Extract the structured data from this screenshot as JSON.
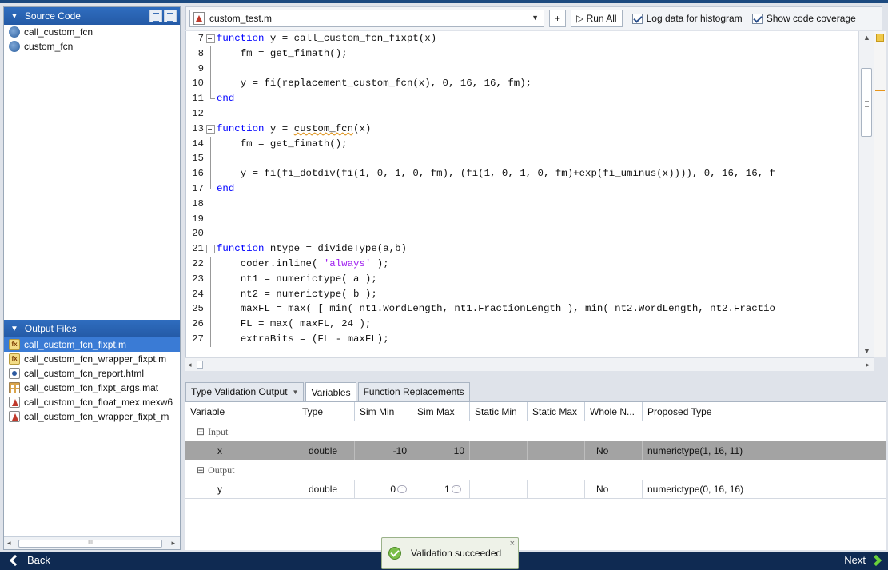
{
  "left": {
    "source_header": "Source Code",
    "source_files": [
      "call_custom_fcn",
      "custom_fcn"
    ],
    "output_header": "Output Files",
    "output_files": [
      {
        "name": "call_custom_fcn_fixpt.m",
        "icon": "fx-m-file-icon",
        "selected": true
      },
      {
        "name": "call_custom_fcn_wrapper_fixpt.m",
        "icon": "fx-m-file-icon",
        "selected": false
      },
      {
        "name": "call_custom_fcn_report.html",
        "icon": "html-file-icon",
        "selected": false
      },
      {
        "name": "call_custom_fcn_fixpt_args.mat",
        "icon": "mat-file-icon",
        "selected": false
      },
      {
        "name": "call_custom_fcn_float_mex.mexw6",
        "icon": "mex-file-icon",
        "selected": false
      },
      {
        "name": "call_custom_fcn_wrapper_fixpt_m",
        "icon": "mex-file-icon",
        "selected": false
      }
    ]
  },
  "toolbar": {
    "file": "custom_test.m",
    "add_label": "+",
    "run_all": "▷ Run All",
    "log_histogram": "Log data for histogram",
    "show_coverage": "Show code coverage"
  },
  "code": {
    "lines": [
      {
        "n": "7",
        "fold": "box",
        "html": "<span class='kw'>function</span> y = call_custom_fcn_fixpt(x)"
      },
      {
        "n": "8",
        "fold": "line",
        "html": "    fm = get_fimath();"
      },
      {
        "n": "9",
        "fold": "line",
        "html": ""
      },
      {
        "n": "10",
        "fold": "line",
        "html": "    y = fi(replacement_custom_fcn(x), 0, 16, 16, fm);"
      },
      {
        "n": "11",
        "fold": "end",
        "html": "<span class='kw'>end</span>"
      },
      {
        "n": "12",
        "fold": "",
        "html": ""
      },
      {
        "n": "13",
        "fold": "box",
        "html": "<span class='kw'>function</span> y = <span class='squig'>custom_fcn</span>(x)"
      },
      {
        "n": "14",
        "fold": "line",
        "html": "    fm = get_fimath();"
      },
      {
        "n": "15",
        "fold": "line",
        "html": ""
      },
      {
        "n": "16",
        "fold": "line",
        "html": "    y = fi(fi_dotdiv(fi(1, 0, 1, 0, fm), (fi(1, 0, 1, 0, fm)+exp(fi_uminus(x)))), 0, 16, 16, f"
      },
      {
        "n": "17",
        "fold": "end",
        "html": "<span class='kw'>end</span>"
      },
      {
        "n": "18",
        "fold": "",
        "html": ""
      },
      {
        "n": "19",
        "fold": "",
        "html": ""
      },
      {
        "n": "20",
        "fold": "",
        "html": ""
      },
      {
        "n": "21",
        "fold": "box",
        "html": "<span class='kw'>function</span> ntype = divideType(a,b)"
      },
      {
        "n": "22",
        "fold": "line",
        "html": "    coder.inline( <span class='str'>'always'</span> );"
      },
      {
        "n": "23",
        "fold": "line",
        "html": "    nt1 = numerictype( a );"
      },
      {
        "n": "24",
        "fold": "line",
        "html": "    nt2 = numerictype( b );"
      },
      {
        "n": "25",
        "fold": "line",
        "html": "    maxFL = max( [ min( nt1.WordLength, nt1.FractionLength ), min( nt2.WordLength, nt2.Fractio"
      },
      {
        "n": "26",
        "fold": "line",
        "html": "    FL = max( maxFL, 24 );"
      },
      {
        "n": "27",
        "fold": "line",
        "html": "    extraBits = (FL - maxFL);"
      }
    ]
  },
  "tabs": [
    "Type Validation Output",
    "Variables",
    "Function Replacements"
  ],
  "table": {
    "headers": [
      "Variable",
      "Type",
      "Sim Min",
      "Sim Max",
      "Static Min",
      "Static Max",
      "Whole N...",
      "Proposed Type"
    ],
    "groups": {
      "input": "Input",
      "output": "Output"
    },
    "rows": [
      {
        "var": "x",
        "type": "double",
        "sim_min": "-10",
        "sim_max": "10",
        "static_min": "",
        "static_max": "",
        "whole": "No",
        "proposed": "numerictype(1, 16, 11)"
      },
      {
        "var": "y",
        "type": "double",
        "sim_min": "0",
        "sim_max": "1",
        "static_min": "",
        "static_max": "",
        "whole": "No",
        "proposed": "numerictype(0, 16, 16)"
      }
    ]
  },
  "nav": {
    "back": "Back",
    "next": "Next"
  },
  "toast": {
    "message": "Validation succeeded",
    "close": "×"
  }
}
